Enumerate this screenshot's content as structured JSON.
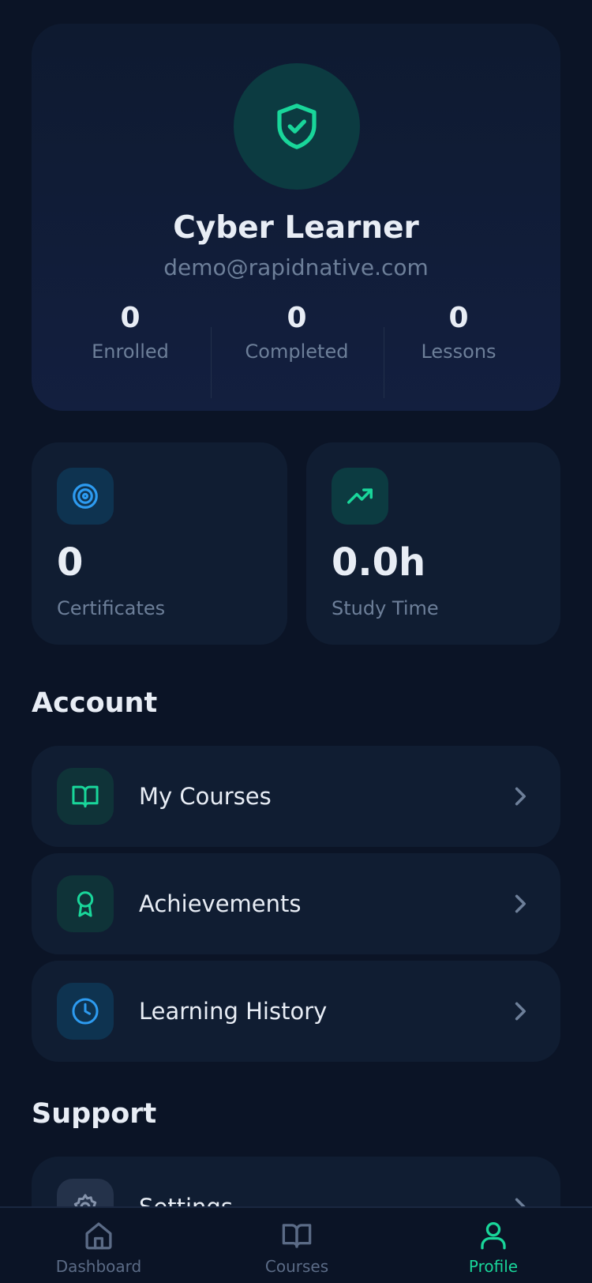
{
  "profile": {
    "name": "Cyber Learner",
    "email": "demo@rapidnative.com",
    "avatar_icon": "shield-check-icon",
    "stats": [
      {
        "value": "0",
        "label": "Enrolled"
      },
      {
        "value": "0",
        "label": "Completed"
      },
      {
        "value": "0",
        "label": "Lessons"
      }
    ]
  },
  "summary_cards": [
    {
      "icon": "target-icon",
      "value": "0",
      "label": "Certificates"
    },
    {
      "icon": "trending-up-icon",
      "value": "0.0h",
      "label": "Study Time"
    }
  ],
  "account": {
    "title": "Account",
    "items": [
      {
        "icon": "book-open-icon",
        "label": "My Courses"
      },
      {
        "icon": "award-icon",
        "label": "Achievements"
      },
      {
        "icon": "clock-icon",
        "label": "Learning History"
      }
    ]
  },
  "support": {
    "title": "Support",
    "items": [
      {
        "icon": "settings-icon",
        "label": "Settings"
      }
    ]
  },
  "nav": {
    "items": [
      {
        "icon": "home-icon",
        "label": "Dashboard",
        "active": false
      },
      {
        "icon": "book-open-icon",
        "label": "Courses",
        "active": false
      },
      {
        "icon": "user-icon",
        "label": "Profile",
        "active": true
      }
    ]
  },
  "colors": {
    "background": "#0b1426",
    "card": "#101d32",
    "accent_green": "#19d69a",
    "accent_blue": "#2d9bf0",
    "muted_text": "#6d7f99",
    "nav_inactive": "#5b6b86"
  }
}
